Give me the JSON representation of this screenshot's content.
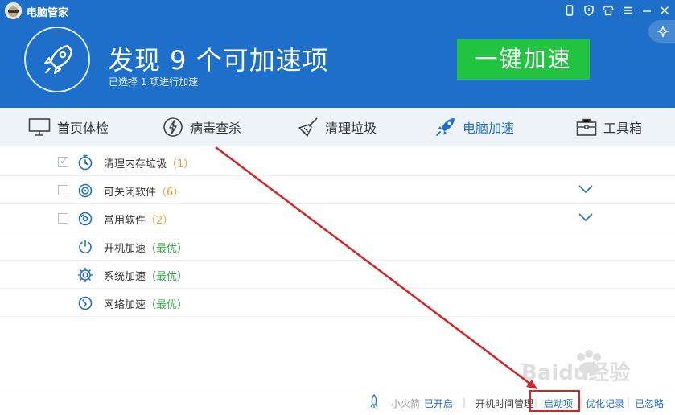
{
  "app": {
    "title": "电脑管家"
  },
  "header": {
    "headline": "发现 9 个可加速项",
    "subline": "已选择 1 项进行加速",
    "accelerate_label": "一键加速"
  },
  "nav": {
    "items": [
      {
        "label": "首页体检",
        "icon": "monitor-icon"
      },
      {
        "label": "病毒查杀",
        "icon": "lightning-shield-icon"
      },
      {
        "label": "清理垃圾",
        "icon": "broom-icon"
      },
      {
        "label": "电脑加速",
        "icon": "rocket-icon"
      },
      {
        "label": "工具箱",
        "icon": "toolbox-icon"
      }
    ]
  },
  "list": {
    "rows": [
      {
        "label": "清理内存垃圾",
        "badge": "（1）",
        "checked": true
      },
      {
        "label": "可关闭软件",
        "badge": "（6）",
        "checked": false
      },
      {
        "label": "常用软件",
        "badge": "（2）",
        "checked": false
      },
      {
        "label": "开机加速",
        "badge": "（最优）"
      },
      {
        "label": "系统加速",
        "badge": "（最优）"
      },
      {
        "label": "网络加速",
        "badge": "（最优）"
      }
    ]
  },
  "footer": {
    "rocket_label": "小火箭",
    "rocket_status": "已开启",
    "sep": "|",
    "links": [
      "开机时间管理",
      "启动项",
      "优化记录",
      "已忽略"
    ]
  },
  "watermark": {
    "text": "Baidu经验"
  },
  "colors": {
    "brand_blue": "#1e6fc9",
    "accent_green": "#21c441",
    "count_orange": "#f29a2e",
    "best_green": "#3aa54a",
    "annotation_red": "#d42424"
  }
}
